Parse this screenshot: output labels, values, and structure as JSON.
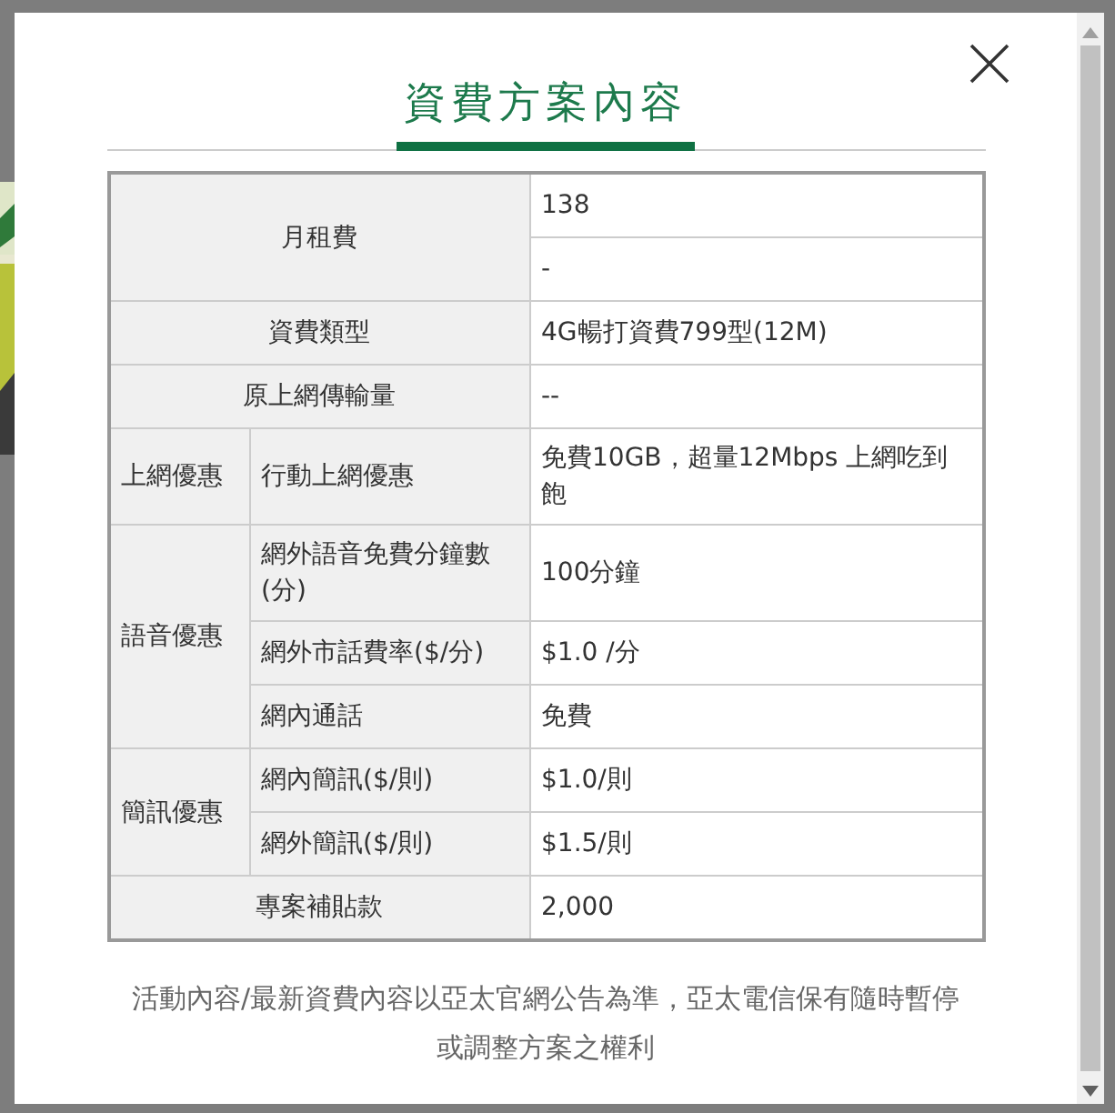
{
  "dialog": {
    "title": "資費方案內容",
    "rows": [
      {
        "kind": "plain",
        "label": "月租費",
        "values": [
          "138",
          "-"
        ]
      },
      {
        "kind": "plain",
        "label": "資費類型",
        "values": [
          "4G暢打資費799型(12M)"
        ]
      },
      {
        "kind": "plain",
        "label": "原上網傳輸量",
        "values": [
          "--"
        ]
      },
      {
        "kind": "group",
        "label": "上網優惠",
        "items": [
          {
            "label": "行動上網優惠",
            "value": "免費10GB，超量12Mbps 上網吃到飽"
          }
        ]
      },
      {
        "kind": "group",
        "label": "語音優惠",
        "items": [
          {
            "label": "網外語音免費分鐘數(分)",
            "value": "100分鐘"
          },
          {
            "label": "網外市話費率($/分)",
            "value": "$1.0 /分"
          },
          {
            "label": "網內通話",
            "value": "免費"
          }
        ]
      },
      {
        "kind": "group",
        "label": "簡訊優惠",
        "items": [
          {
            "label": "網內簡訊($/則)",
            "value": "$1.0/則"
          },
          {
            "label": "網外簡訊($/則)",
            "value": "$1.5/則"
          }
        ]
      },
      {
        "kind": "plain",
        "label": "專案補貼款",
        "values": [
          "2,000"
        ]
      }
    ],
    "note": "活動內容/最新資費內容以亞太官網公告為準，亞太電信保有隨時暫停或調整方案之權利"
  }
}
